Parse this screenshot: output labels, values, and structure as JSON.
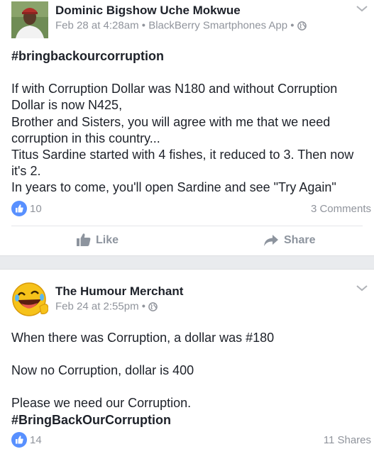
{
  "posts": [
    {
      "author": "Dominic Bigshow Uche Mokwue",
      "date": "Feb 28 at 4:28am",
      "separator": "•",
      "source": "BlackBerry Smartphones App",
      "hashtag": "#bringbackourcorruption",
      "lines": [
        "If with Corruption Dollar was N180 and without Corruption Dollar is now N425,",
        "Brother and Sisters, you will agree with me that we need corruption in this country...",
        "Titus Sardine started with 4 fishes, it reduced to 3. Then now it's 2.",
        "In years to come, you'll open Sardine and see \"Try Again\""
      ],
      "likes": "10",
      "comments": "3 Comments",
      "like_label": "Like",
      "share_label": "Share"
    },
    {
      "author": "The Humour Merchant",
      "date": "Feb 24 at 2:55pm",
      "separator": "•",
      "line1": "When there was Corruption, a dollar was #180",
      "line2": "Now no Corruption, dollar is 400",
      "line3": "Please we need our Corruption.",
      "hashtag": "#BringBackOurCorruption",
      "likes": "14",
      "shares": "11 Shares"
    }
  ],
  "colors": {
    "text": "#1d2129",
    "meta": "#90949c",
    "like_blue": "#5890ff",
    "feed_bg": "#e9ebee"
  },
  "icons": [
    "globe-icon",
    "chevron-down-icon",
    "thumbs-up-icon",
    "share-arrow-icon"
  ]
}
